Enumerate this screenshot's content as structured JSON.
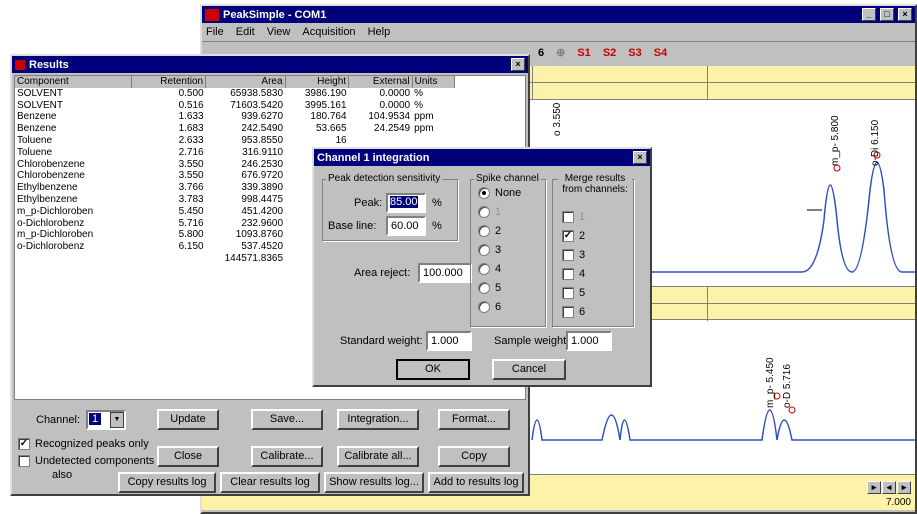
{
  "main_window": {
    "title": "PeakSimple - COM1",
    "menu": [
      "File",
      "Edit",
      "View",
      "Acquisition",
      "Help"
    ],
    "toolbar_items": [
      "6",
      "S1",
      "S2",
      "S3",
      "S4"
    ],
    "time_end": "7.000",
    "top_peaks": [
      "o 3.550",
      "m_p- 5.800",
      "o-Di 6.150"
    ],
    "bottom_peaks": [
      "m_p- 5.450",
      "o-D 5.716"
    ]
  },
  "results": {
    "title": "Results",
    "columns": [
      "Component",
      "Retention",
      "Area",
      "Height",
      "External",
      "Units"
    ],
    "rows": [
      [
        "SOLVENT",
        "0.500",
        "65938.5830",
        "3986.190",
        "0.0000",
        "%"
      ],
      [
        "SOLVENT",
        "0.516",
        "71603.5420",
        "3995.161",
        "0.0000",
        "%"
      ],
      [
        "Benzene",
        "1.633",
        "939.6270",
        "180.764",
        "104.9534",
        "ppm"
      ],
      [
        "Benzene",
        "1.683",
        "242.5490",
        "53.665",
        "24.2549",
        "ppm"
      ],
      [
        "Toluene",
        "2.633",
        "953.8550",
        "16",
        "",
        ""
      ],
      [
        "Toluene",
        "2.716",
        "316.9110",
        "",
        "",
        ""
      ],
      [
        "Chlorobenzene",
        "3.550",
        "246.2530",
        "",
        "",
        ""
      ],
      [
        "Chlorobenzene",
        "3.550",
        "676.9720",
        "1",
        "",
        ""
      ],
      [
        "Ethylbenzene",
        "3.766",
        "339.3890",
        "",
        "",
        ""
      ],
      [
        "Ethylbenzene",
        "3.783",
        "998.4475",
        "1",
        "",
        ""
      ],
      [
        "m_p-Dichloroben",
        "5.450",
        "451.4200",
        "",
        "",
        ""
      ],
      [
        "o-Dichlorobenz",
        "5.716",
        "232.9600",
        "",
        "",
        ""
      ],
      [
        "m_p-Dichloroben",
        "5.800",
        "1093.8760",
        "1",
        "",
        ""
      ],
      [
        "o-Dichlorobenz",
        "6.150",
        "537.4520",
        "",
        "",
        ""
      ],
      [
        "",
        "",
        "144571.8365",
        "",
        "",
        ""
      ]
    ],
    "channel_label": "Channel:",
    "channel_value": "1",
    "buttons": {
      "update": "Update",
      "save": "Save...",
      "integration": "Integration...",
      "format": "Format...",
      "close": "Close",
      "calibrate": "Calibrate...",
      "calibrate_all": "Calibrate all...",
      "copy": "Copy",
      "copy_log": "Copy results log",
      "clear_log": "Clear results log",
      "show_log": "Show results log...",
      "add_log": "Add to results log"
    },
    "recognized_label": "Recognized peaks only",
    "undetected_label": "Undetected components",
    "also_label": "also"
  },
  "integration": {
    "title": "Channel 1 integration",
    "sensitivity_group": "Peak detection sensitivity",
    "peak_label": "Peak:",
    "peak_value": "85.00",
    "baseline_label": "Base line:",
    "baseline_value": "60.00",
    "pct": "%",
    "area_reject_label": "Area reject:",
    "area_reject_value": "100.000",
    "spike_group": "Spike channel",
    "spike_options": [
      "None",
      "1",
      "2",
      "3",
      "4",
      "5",
      "6"
    ],
    "merge_group": "Merge results from channels:",
    "merge_options": [
      "1",
      "2",
      "3",
      "4",
      "5",
      "6"
    ],
    "std_weight_label": "Standard weight:",
    "std_weight_value": "1.000",
    "sample_weight_label": "Sample weight:",
    "sample_weight_value": "1.000",
    "ok": "OK",
    "cancel": "Cancel"
  }
}
